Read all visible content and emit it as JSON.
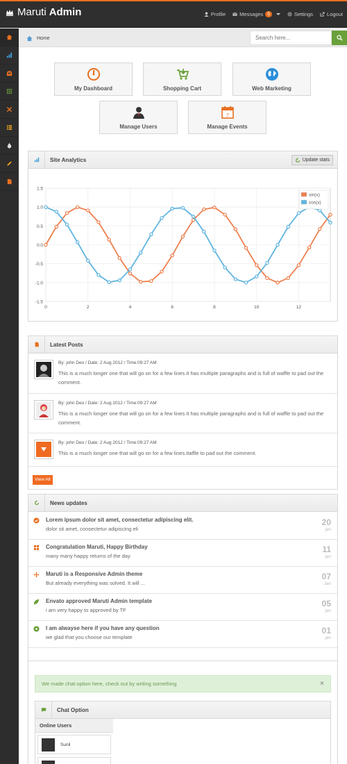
{
  "brand": {
    "name": "Maruti",
    "name_bold": "Admin"
  },
  "topnav": {
    "profile": "Profile",
    "messages": "Messages",
    "messages_count": "5",
    "settings": "Settings",
    "logout": "Logout"
  },
  "sidebar": {
    "icons": [
      "home-icon",
      "signal-icon",
      "inbox-icon",
      "grid-icon",
      "wrench-icon",
      "list-icon",
      "tint-icon",
      "pencil-icon",
      "file-icon"
    ]
  },
  "breadcrumb": {
    "home": "Home"
  },
  "search": {
    "placeholder": "Search here..."
  },
  "quick_actions": [
    {
      "label": "My Dashboard"
    },
    {
      "label": "Shopping Cart"
    },
    {
      "label": "Web Marketing"
    },
    {
      "label": "Manage Users"
    },
    {
      "label": "Manage Events"
    }
  ],
  "analytics": {
    "title": "Site Analytics",
    "update_label": "Update stats"
  },
  "chart_data": {
    "type": "line",
    "x": [
      0,
      0.5,
      1,
      1.5,
      2,
      2.5,
      3,
      3.5,
      4,
      4.5,
      5,
      5.5,
      6,
      6.5,
      7,
      7.5,
      8,
      8.5,
      9,
      9.5,
      10,
      10.5,
      11,
      11.5,
      12,
      12.5,
      13,
      13.5
    ],
    "series": [
      {
        "name": "sin(x)",
        "color": "#ef7f4d",
        "values": [
          0,
          0.48,
          0.84,
          1.0,
          0.91,
          0.6,
          0.14,
          -0.35,
          -0.76,
          -0.98,
          -0.96,
          -0.71,
          -0.28,
          0.22,
          0.66,
          0.94,
          0.99,
          0.8,
          0.41,
          -0.08,
          -0.54,
          -0.88,
          -1.0,
          -0.88,
          -0.54,
          -0.07,
          0.42,
          0.8
        ]
      },
      {
        "name": "cos(x)",
        "color": "#5fb4e0",
        "values": [
          1.0,
          0.88,
          0.54,
          0.07,
          -0.42,
          -0.8,
          -0.99,
          -0.94,
          -0.65,
          -0.21,
          0.28,
          0.71,
          0.96,
          0.98,
          0.75,
          0.35,
          -0.15,
          -0.6,
          -0.91,
          -1.0,
          -0.84,
          -0.48,
          0.0,
          0.48,
          0.84,
          1.0,
          0.91,
          0.59
        ]
      }
    ],
    "xlim": [
      0,
      13.5
    ],
    "ylim": [
      -1.5,
      1.5
    ],
    "xticks": [
      "0",
      "2",
      "4",
      "6",
      "8",
      "10",
      "12"
    ],
    "yticks": [
      "1.5",
      "1.0",
      "0.5",
      "0.0",
      "-0.5",
      "-1.0",
      "-1.5"
    ],
    "grid": true,
    "legend": "top-right"
  },
  "posts": {
    "title": "Latest Posts",
    "items": [
      {
        "meta": "By: john Deo / Date: 2 Aug 2012 / Time:09:27 AM",
        "text": "This is a much longer one that will go on for a few lines.It has multiple paragraphs and is full of waffle to pad out the comment."
      },
      {
        "meta": "By: john Deo / Date: 2 Aug 2012 / Time:09:27 AM",
        "text": "This is a much longer one that will go on for a few lines.It has multiple paragraphs and is full of waffle to pad out the comment."
      },
      {
        "meta": "By: john Deo / Date: 2 Aug 2012 / Time:09:27 AM",
        "text": "This is a much longer one that will go on for a few lines.Itaffle to pad out the comment."
      }
    ],
    "view_all": "View All"
  },
  "news": {
    "title": "News updates",
    "items": [
      {
        "title": "Lorem ipsum dolor sit amet, consectetur adipiscing elit.",
        "sub": "dolor sit amet, consectetur adipiscing eli",
        "day": "20",
        "month": "jan",
        "color": "#e8701f"
      },
      {
        "title": "Congratulation Maruti, Happy Birthday",
        "sub": "many many happy returns of the day",
        "day": "11",
        "month": "jan",
        "color": "#e8701f"
      },
      {
        "title": "Maruti is a Responsive Admin theme",
        "sub": "But already everything was solved. It will ...",
        "day": "07",
        "month": "Jan",
        "color": "#e8701f"
      },
      {
        "title": "Envato approved Maruti Admin template",
        "sub": "i am very happy to approved by TF",
        "day": "05",
        "month": "jan",
        "color": "#6aa13a"
      },
      {
        "title": "I am alwayse here if you have any question",
        "sub": "we glad that you choose our template",
        "day": "01",
        "month": "jan",
        "color": "#6aa13a"
      }
    ]
  },
  "chat": {
    "alert": "We made chat option here, check out by writing something",
    "close": "×",
    "title": "Chat Option",
    "online_users": "Online Users",
    "users": [
      {
        "name": "Sunil"
      },
      {
        "name": ""
      }
    ]
  }
}
